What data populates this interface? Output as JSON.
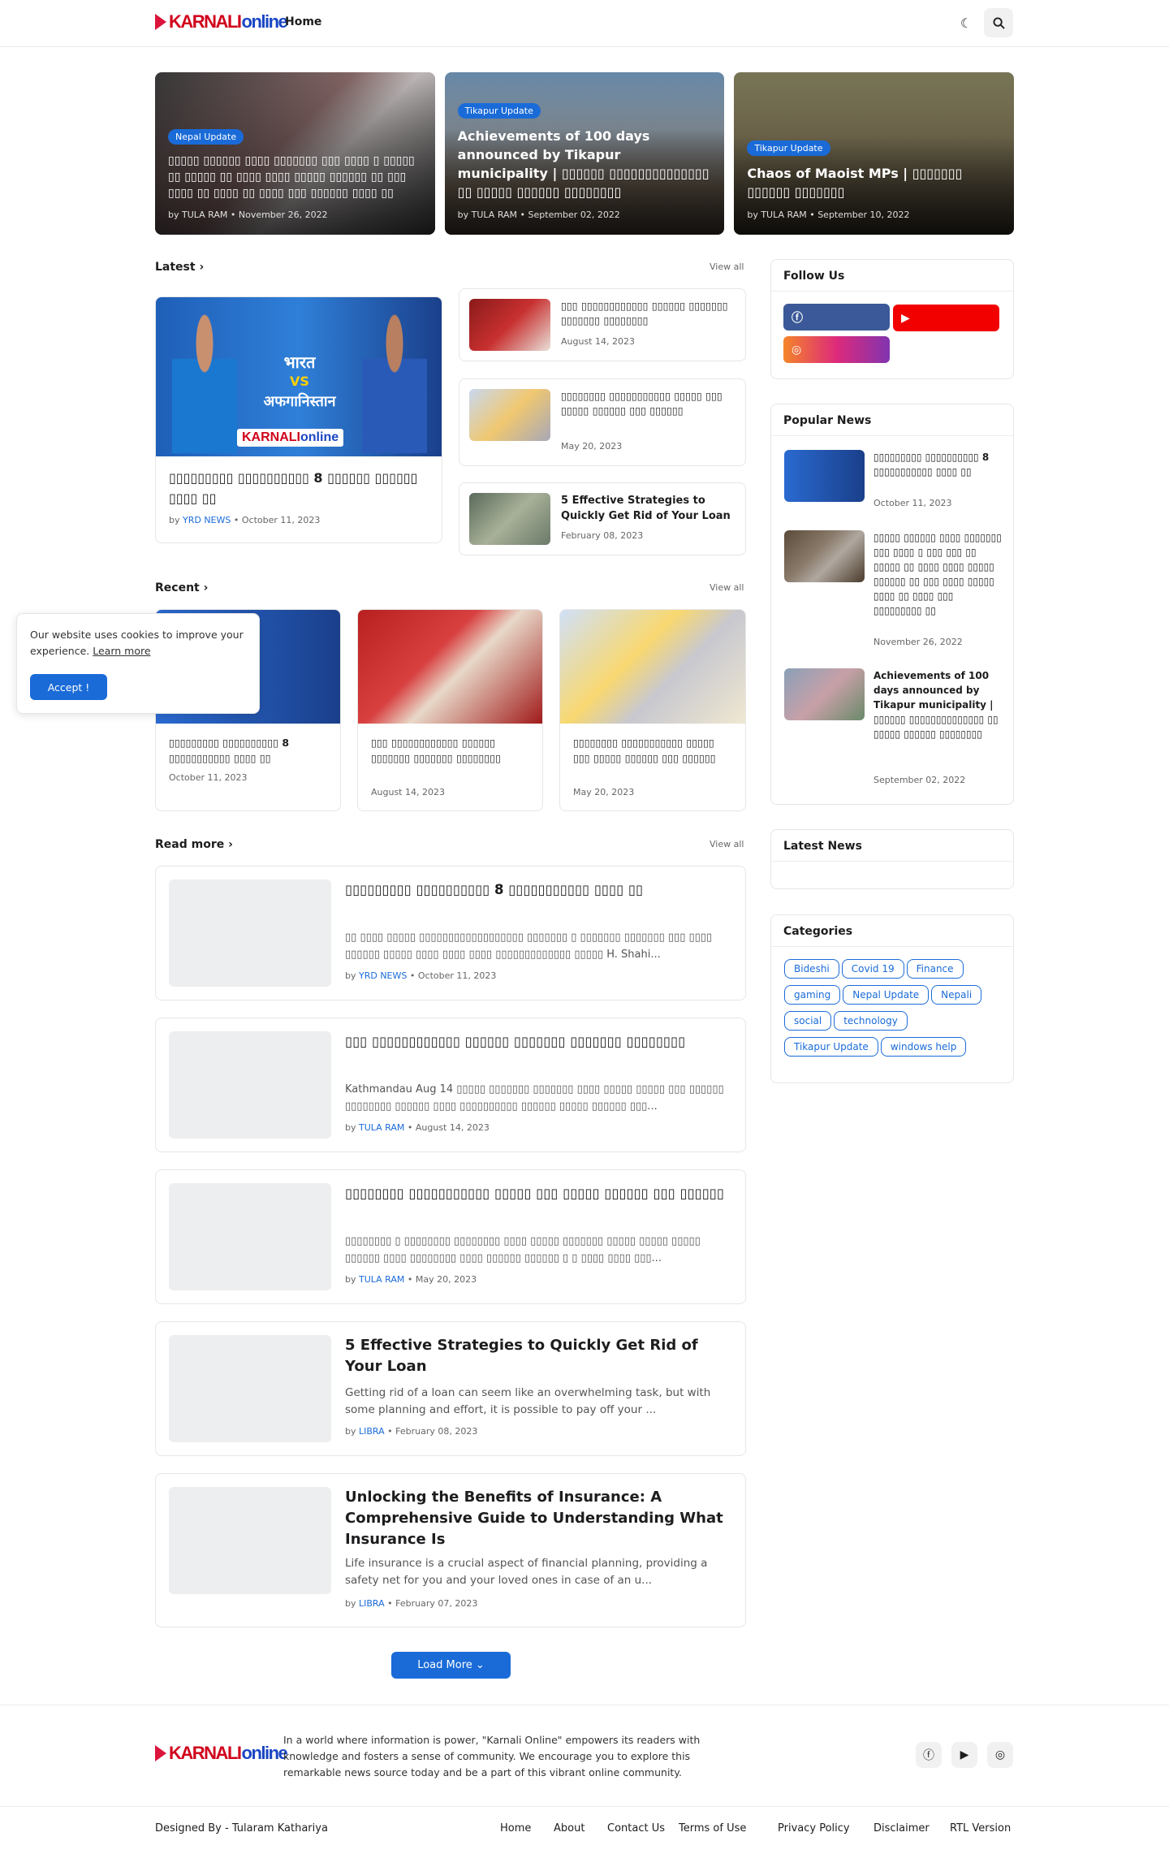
{
  "header": {
    "logo_karnali": "KARNALI",
    "logo_online": "online",
    "nav_home": "Home",
    "theme_icon": "moon-icon",
    "search_icon": "search-icon"
  },
  "featured": [
    {
      "tag": "Nepal Update",
      "title": "▯▯▯▯▯ ▯▯▯▯▯▯ ▯▯▯▯ ▯▯▯▯▯▯▯ ▯▯▯ ▯▯▯▯ ▯ ▯▯▯▯▯ ▯▯ ▯▯▯▯▯ ▯▯ ▯▯▯▯ ▯▯▯▯ ▯▯▯▯▯ ▯▯▯▯▯▯ ▯▯ ▯▯▯ ▯▯▯▯ ▯▯ ▯▯▯▯ ▯▯ ▯▯▯▯ ▯▯▯ ▯▯▯▯▯▯ ▯▯▯▯ ▯▯",
      "meta": "by TULA RAM • November 26, 2022"
    },
    {
      "tag": "Tikapur Update",
      "title": "Achievements of 100 days announced by Tikapur municipality | ▯▯▯▯▯▯ ▯▯▯▯▯▯▯▯▯▯▯▯▯▯ ▯▯ ▯▯▯▯▯ ▯▯▯▯▯▯ ▯▯▯▯▯▯▯▯",
      "meta": "by TULA RAM • September 02, 2022"
    },
    {
      "tag": "Tikapur Update",
      "title": "Chaos of Maoist MPs | ▯▯▯▯▯▯▯ ▯▯▯▯▯▯ ▯▯▯▯▯▯▯",
      "meta": "by TULA RAM • September 10, 2022"
    }
  ],
  "latest": {
    "heading": "Latest",
    "view_all": "View all",
    "main": {
      "title": "▯▯▯▯▯▯▯▯▯ ▯▯▯▯▯▯▯▯▯▯ 8 ▯▯▯▯▯▯ ▯▯▯▯▯▯ ▯▯▯▯ ▯▯",
      "by": "by ",
      "author": "YRD NEWS",
      "date": " • October 11, 2023",
      "img_bharat": "भारत",
      "img_vs": "VS",
      "img_afg": "अफगानिस्तान"
    },
    "items": [
      {
        "title": "▯▯▯ ▯▯▯▯▯▯▯▯▯▯▯▯ ▯▯▯▯▯▯ ▯▯▯▯▯▯▯ ▯▯▯▯▯▯▯ ▯▯▯▯▯▯▯▯",
        "date": "August 14, 2023"
      },
      {
        "title": "▯▯▯▯▯▯▯▯ ▯▯▯▯▯▯▯▯▯▯▯ ▯▯▯▯▯ ▯▯▯ ▯▯▯▯▯ ▯▯▯▯▯▯ ▯▯▯ ▯▯▯▯▯▯",
        "date": "May 20, 2023"
      },
      {
        "title": "5 Effective Strategies to Quickly Get Rid of Your Loan",
        "date": "February 08, 2023"
      }
    ]
  },
  "recent": {
    "heading": "Recent",
    "view_all": "View all",
    "items": [
      {
        "title": "▯▯▯▯▯▯▯▯▯ ▯▯▯▯▯▯▯▯▯▯ 8 ▯▯▯▯▯▯▯▯▯▯▯ ▯▯▯▯ ▯▯",
        "date": "October 11, 2023"
      },
      {
        "title": "▯▯▯ ▯▯▯▯▯▯▯▯▯▯▯▯ ▯▯▯▯▯▯ ▯▯▯▯▯▯▯ ▯▯▯▯▯▯▯ ▯▯▯▯▯▯▯▯",
        "date": "August 14, 2023"
      },
      {
        "title": "▯▯▯▯▯▯▯▯ ▯▯▯▯▯▯▯▯▯▯▯ ▯▯▯▯▯ ▯▯▯ ▯▯▯▯▯ ▯▯▯▯▯▯ ▯▯▯ ▯▯▯▯▯▯",
        "date": "May 20, 2023"
      }
    ]
  },
  "cookie": {
    "text": "Our website uses cookies to improve your experience. ",
    "learn": "Learn more",
    "accept": "Accept !"
  },
  "readmore": {
    "heading": "Read more",
    "view_all": "View all",
    "items": [
      {
        "title": "▯▯▯▯▯▯▯▯▯ ▯▯▯▯▯▯▯▯▯▯ 8 ▯▯▯▯▯▯▯▯▯▯▯ ▯▯▯▯ ▯▯",
        "desc": "▯▯ ▯▯▯▯ ▯▯▯▯▯ ▯▯▯▯▯▯▯▯▯▯▯▯▯▯▯▯▯▯ ▯▯▯▯▯▯▯ ▯ ▯▯▯▯▯▯▯ ▯▯▯▯▯▯▯ ▯▯▯ ▯▯▯▯ ▯▯▯▯▯▯ ▯▯▯▯▯ ▯▯▯▯ ▯▯▯▯ ▯▯▯▯ ▯▯▯▯▯▯▯▯▯▯▯▯▯ ▯▯▯▯▯ H. Shahi...",
        "author": "YRD NEWS",
        "date": " • October 11, 2023"
      },
      {
        "title": "▯▯▯ ▯▯▯▯▯▯▯▯▯▯▯▯ ▯▯▯▯▯▯ ▯▯▯▯▯▯▯ ▯▯▯▯▯▯▯ ▯▯▯▯▯▯▯▯",
        "desc": "Kathmandau Aug 14 ▯▯▯▯▯ ▯▯▯▯▯▯▯ ▯▯▯▯▯▯▯ ▯▯▯▯ ▯▯▯▯▯ ▯▯▯▯▯ ▯▯▯ ▯▯▯▯▯▯ ▯▯▯▯▯▯▯▯ ▯▯▯▯▯▯ ▯▯▯▯ ▯▯▯▯▯▯▯▯▯▯ ▯▯▯▯▯▯ ▯▯▯▯▯ ▯▯▯▯▯▯ ▯▯▯...",
        "author": "TULA RAM",
        "date": " • August 14, 2023"
      },
      {
        "title": "▯▯▯▯▯▯▯▯ ▯▯▯▯▯▯▯▯▯▯▯ ▯▯▯▯▯ ▯▯▯ ▯▯▯▯▯ ▯▯▯▯▯▯ ▯▯▯ ▯▯▯▯▯▯",
        "desc": "▯▯▯▯▯▯▯▯ ▯ ▯▯▯▯▯▯▯▯ ▯▯▯▯▯▯▯▯ ▯▯▯▯ ▯▯▯▯▯ ▯▯▯▯▯▯▯ ▯▯▯▯▯ ▯▯▯▯▯ ▯▯▯▯▯ ▯▯▯▯▯▯ ▯▯▯▯ ▯▯▯▯▯▯▯▯ ▯▯▯▯ ▯▯▯▯▯▯ ▯▯▯▯▯▯ ▯ ▯ ▯▯▯▯ ▯▯▯▯ ▯▯▯...",
        "author": "TULA RAM",
        "date": " • May 20, 2023"
      },
      {
        "title": "5 Effective Strategies to Quickly Get Rid of Your Loan",
        "desc": "Getting rid of a loan can seem like an overwhelming task, but with some planning and effort, it is possible to pay off your ...",
        "author": "LIBRA",
        "date": " • February 08, 2023"
      },
      {
        "title": "Unlocking the Benefits of Insurance: A Comprehensive Guide to Understanding What Insurance Is",
        "desc": "Life insurance is a crucial aspect of financial planning, providing a safety net for you and your loved ones in case of an u...",
        "author": "LIBRA",
        "date": " • February 07, 2023"
      }
    ],
    "by": "by ",
    "load_more": "Load More ⌄"
  },
  "sidebar": {
    "follow": "Follow Us",
    "popular": "Popular News",
    "popular_items": [
      {
        "title": "▯▯▯▯▯▯▯▯▯ ▯▯▯▯▯▯▯▯▯▯ 8 ▯▯▯▯▯▯▯▯▯▯▯ ▯▯▯▯ ▯▯",
        "date": "October 11, 2023"
      },
      {
        "title": "▯▯▯▯▯ ▯▯▯▯▯▯ ▯▯▯▯ ▯▯▯▯▯▯▯ ▯▯▯ ▯▯▯▯ ▯ ▯▯▯ ▯▯▯ ▯▯ ▯▯▯▯▯ ▯▯ ▯▯▯▯ ▯▯▯▯ ▯▯▯▯▯ ▯▯▯▯▯▯ ▯▯ ▯▯▯ ▯▯▯▯ ▯▯▯▯▯ ▯▯▯▯ ▯▯ ▯▯▯▯ ▯▯▯ ▯▯▯▯▯▯▯▯▯ ▯▯",
        "date": "November 26, 2022"
      },
      {
        "title": "Achievements of 100 days announced by Tikapur municipality | ▯▯▯▯▯▯ ▯▯▯▯▯▯▯▯▯▯▯▯▯▯ ▯▯ ▯▯▯▯▯ ▯▯▯▯▯▯ ▯▯▯▯▯▯▯▯",
        "date": "September 02, 2022"
      }
    ],
    "latest_news": "Latest News",
    "categories": "Categories",
    "cats": [
      "Bideshi",
      "Covid 19",
      "Finance",
      "gaming",
      "Nepal Update",
      "Nepali",
      "social",
      "technology",
      "Tikapur Update",
      "windows help"
    ]
  },
  "footer": {
    "about": "In a world where information is power, \"Karnali Online\" empowers its readers with knowledge and fosters a sense of community. We encourage you to explore this remarkable news source today and be a part of this vibrant online community.",
    "designed": "Designed By - Tularam Kathariya",
    "links": [
      "Home",
      "About",
      "Contact Us",
      "Terms of Use",
      "Privacy Policy",
      "Disclaimer",
      "RTL Version"
    ]
  },
  "colors": {
    "accent": "#1a6bd8",
    "facebook": "#3b5998",
    "youtube": "#f20000",
    "instagram_from": "#f58529",
    "instagram_to": "#8134af"
  }
}
